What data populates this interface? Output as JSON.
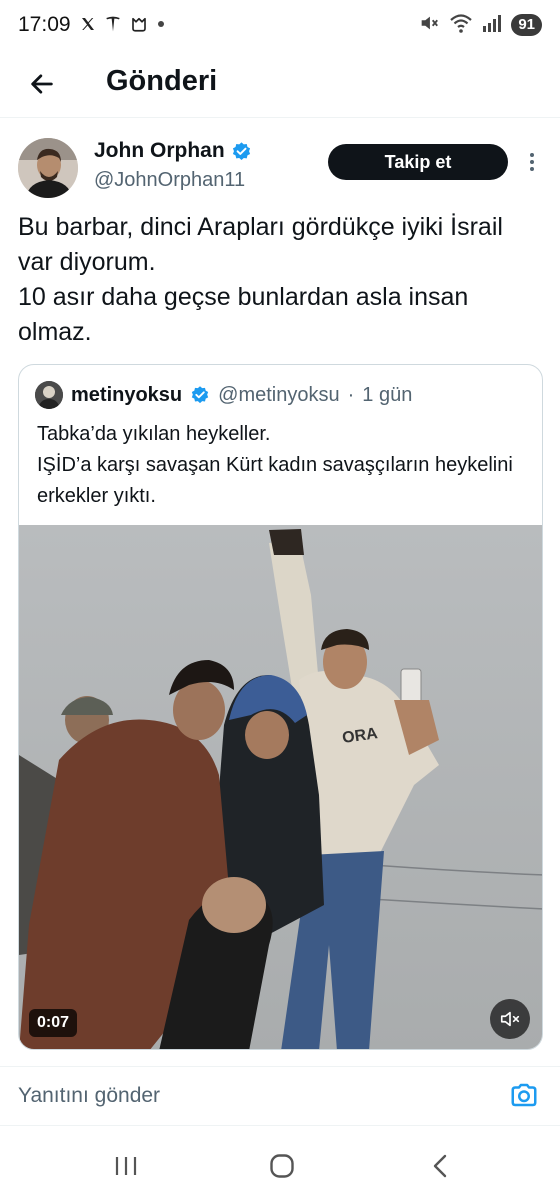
{
  "status_bar": {
    "time": "17:09",
    "left_icons": [
      "x-logo-icon",
      "tesla-icon",
      "app-icon",
      "dot-icon"
    ],
    "right_icons": [
      "mute-icon",
      "wifi-icon",
      "signal-icon"
    ],
    "battery": "91"
  },
  "header": {
    "title": "Gönderi"
  },
  "author": {
    "name": "John Orphan",
    "handle": "@JohnOrphan11",
    "verified": true,
    "follow_label": "Takip et"
  },
  "tweet": {
    "lines": [
      "Bu barbar, dinci Arapları gördükçe iyiki İsrail var diyorum.",
      "10 asır daha geçse bunlardan asla insan olmaz."
    ]
  },
  "quote": {
    "name": "metinyoksu",
    "handle": "@metinyoksu",
    "separator": "·",
    "time": "1 gün",
    "verified": true,
    "lines": [
      "Tabka’da yıkılan heykeller.",
      "IŞİD’a karşı savaşan Kürt kadın savaşçıların heykelini erkekler yıktı."
    ],
    "media": {
      "duration": "0:07",
      "muted": true,
      "sweatshirt_text": "ORA"
    }
  },
  "reply": {
    "placeholder": "Yanıtını gönder"
  },
  "colors": {
    "text": "#0f1419",
    "secondary": "#536471",
    "verified": "#1d9bf0",
    "border": "#cfd9de"
  }
}
